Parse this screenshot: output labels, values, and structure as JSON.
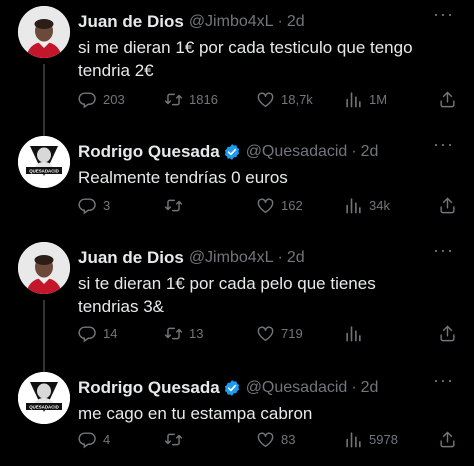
{
  "tweets": [
    {
      "name": "Juan de Dios",
      "handle": "@Jimbo4xL",
      "time": "2d",
      "verified": false,
      "text_lines": [
        "si me dieran 1€ por cada testiculo que tengo",
        "tendria 2€"
      ],
      "replies": "203",
      "retweets": "1816",
      "likes": "18,7k",
      "views": "1M",
      "avatar": "avatar-juan"
    },
    {
      "name": "Rodrigo Quesada",
      "handle": "@Quesadacid",
      "time": "2d",
      "verified": true,
      "text_lines": [
        "Realmente tendrías 0 euros"
      ],
      "replies": "3",
      "retweets": "",
      "likes": "162",
      "views": "34k",
      "avatar": "avatar-rodrigo"
    },
    {
      "name": "Juan de Dios",
      "handle": "@Jimbo4xL",
      "time": "2d",
      "verified": false,
      "text_lines": [
        "si te dieran 1€ por cada pelo que tienes",
        "tendrias 3&"
      ],
      "replies": "14",
      "retweets": "13",
      "likes": "719",
      "views": "",
      "avatar": "avatar-juan"
    },
    {
      "name": "Rodrigo Quesada",
      "handle": "@Quesadacid",
      "time": "2d",
      "verified": true,
      "text_lines": [
        "me cago en tu estampa cabron"
      ],
      "replies": "4",
      "retweets": "",
      "likes": "83",
      "views": "5978",
      "avatar": "avatar-rodrigo"
    }
  ],
  "ui": {
    "more_glyph": "···",
    "dot": "·",
    "accent": "#1d9bf0",
    "muted": "#71767b"
  },
  "avatar_text": {
    "rodrigo": "QUESADACID"
  }
}
